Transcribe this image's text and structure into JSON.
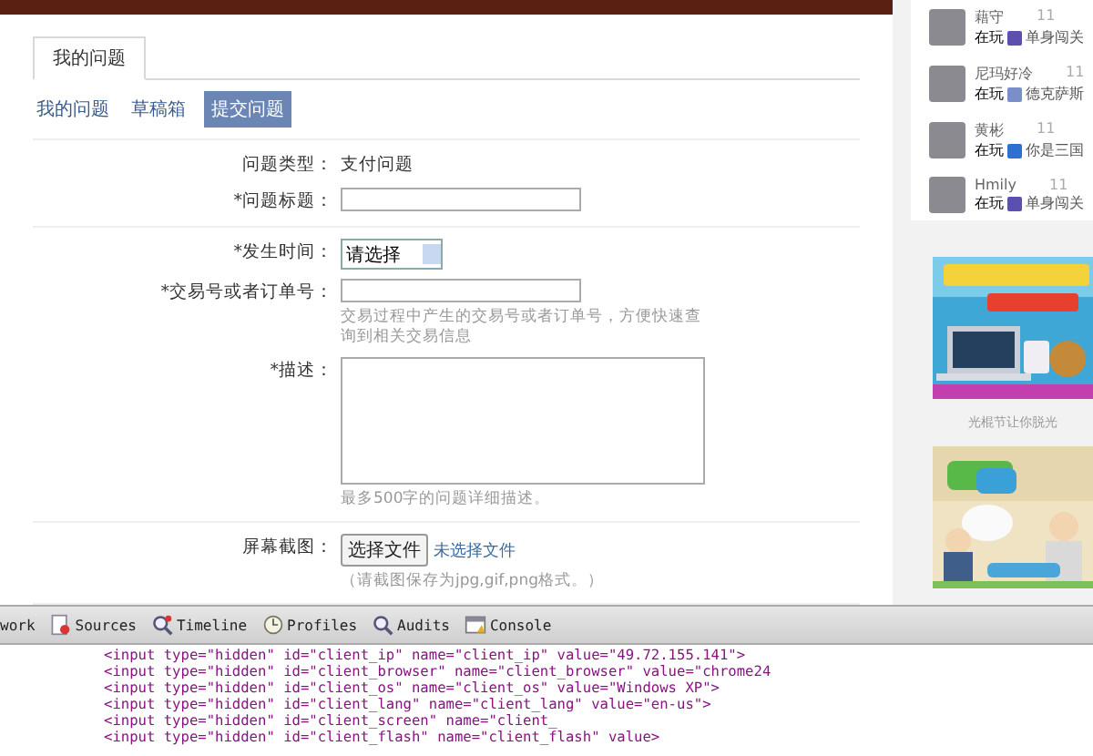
{
  "tabs": [
    {
      "label": "我的问题",
      "selected": true
    }
  ],
  "subtabs": [
    {
      "label": "我的问题",
      "selected": false
    },
    {
      "label": "草稿箱",
      "selected": false
    },
    {
      "label": "提交问题",
      "selected": true
    }
  ],
  "form": {
    "sections": [
      [
        {
          "kind": "text",
          "label": "问题类型：",
          "value": "支付问题"
        },
        {
          "kind": "input",
          "label": "*问题标题："
        }
      ],
      [
        {
          "kind": "select",
          "label": "*发生时间：",
          "value": "请选择"
        },
        {
          "kind": "input",
          "label": "*交易号或者订单号：",
          "hint": "交易过程中产生的交易号或者订单号，方便快速查询到相关交易信息"
        },
        {
          "kind": "textarea",
          "label": "*描述：",
          "hint": "最多500字的问题详细描述。"
        }
      ],
      [
        {
          "kind": "file",
          "label": "屏幕截图：",
          "button": "选择文件",
          "status": "未选择文件",
          "hint": "（请截图保存为jpg,gif,png格式。）"
        }
      ]
    ]
  },
  "friends": [
    {
      "name": "藉守",
      "time": "11",
      "status": "在玩",
      "game": "单身闯关"
    },
    {
      "name": "尼玛好冷",
      "time": "11",
      "status": "在玩",
      "game": "德克萨斯"
    },
    {
      "name": "黄彬",
      "time": "11",
      "status": "在玩",
      "game": "你是三国"
    },
    {
      "name": "Hmily",
      "time": "11",
      "status": "在玩",
      "game": "单身闯关"
    }
  ],
  "ads": [
    {
      "kind": "picture",
      "caption": "光棍节让你脱光"
    },
    {
      "kind": "picture"
    }
  ],
  "devtools": {
    "tabs": [
      {
        "label": "work"
      },
      {
        "label": "Sources"
      },
      {
        "label": "Timeline"
      },
      {
        "label": "Profiles"
      },
      {
        "label": "Audits"
      },
      {
        "label": "Console"
      }
    ],
    "code_lines": [
      "<input type=\"hidden\" id=\"client_ip\" name=\"client_ip\" value=\"49.72.155.141\">",
      "<input type=\"hidden\" id=\"client_browser\" name=\"client_browser\" value=\"chrome24",
      "<input type=\"hidden\" id=\"client_os\" name=\"client_os\" value=\"Windows XP\">",
      "<input type=\"hidden\" id=\"client_lang\" name=\"client_lang\" value=\"en-us\">",
      "<input type=\"hidden\" id=\"client_screen\" name=\"client_",
      "<input type=\"hidden\" id=\"client_flash\" name=\"client_flash\" value>"
    ]
  }
}
